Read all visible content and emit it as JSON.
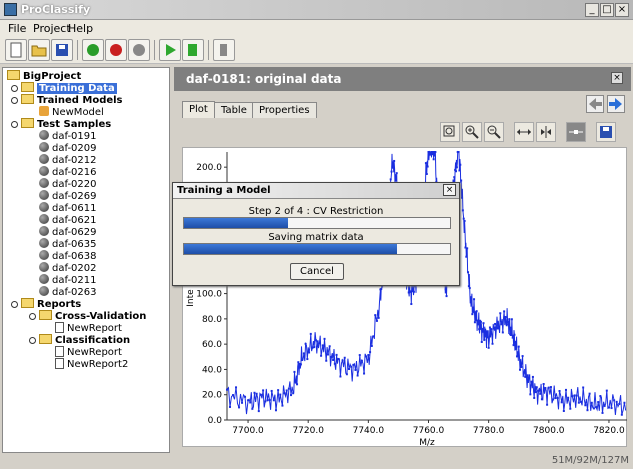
{
  "window": {
    "title": "ProClassify"
  },
  "menu": [
    "File",
    "Project",
    "Help"
  ],
  "tree": {
    "root": "BigProject",
    "training_data": "Training Data",
    "trained_models": "Trained Models",
    "new_model": "NewModel",
    "test_samples": "Test Samples",
    "samples": [
      "daf-0191",
      "daf-0209",
      "daf-0212",
      "daf-0216",
      "daf-0220",
      "daf-0269",
      "daf-0611",
      "daf-0621",
      "daf-0629",
      "daf-0635",
      "daf-0638",
      "daf-0202",
      "daf-0211",
      "daf-0263"
    ],
    "reports": "Reports",
    "cross_validation": "Cross-Validation",
    "cv_reports": [
      "NewReport"
    ],
    "classification": "Classification",
    "class_reports": [
      "NewReport",
      "NewReport2"
    ]
  },
  "panel": {
    "title": "daf-0181: original data",
    "tabs": [
      "Plot",
      "Table",
      "Properties"
    ],
    "active_tab": "Plot"
  },
  "chart_data": {
    "type": "line",
    "title": "",
    "xlabel": "M/z",
    "ylabel": "Inte",
    "xlim": [
      7693,
      7826
    ],
    "ylim": [
      0,
      212
    ],
    "x_ticks": [
      "7700.0",
      "7720.0",
      "7740.0",
      "7760.0",
      "7780.0",
      "7800.0",
      "7820.0"
    ],
    "y_ticks": [
      "0.0",
      "20.0",
      "40.0",
      "60.0",
      "80.0",
      "100.0",
      "200.0"
    ],
    "series": [
      {
        "color": "#1a2ee0",
        "x": [
          7693,
          7700,
          7705,
          7710,
          7715,
          7718,
          7722,
          7726,
          7730,
          7735,
          7740,
          7744,
          7746,
          7748,
          7750,
          7752,
          7754,
          7756,
          7758,
          7760,
          7762,
          7764,
          7766,
          7768,
          7770,
          7772,
          7774,
          7776,
          7778,
          7780,
          7783,
          7786,
          7788,
          7790,
          7793,
          7796,
          7800,
          7805,
          7810,
          7815,
          7820,
          7826
        ],
        "y": [
          20,
          14,
          18,
          16,
          25,
          50,
          62,
          55,
          45,
          40,
          48,
          95,
          150,
          205,
          180,
          120,
          100,
          110,
          170,
          212,
          215,
          140,
          100,
          180,
          215,
          150,
          95,
          80,
          70,
          65,
          75,
          80,
          68,
          50,
          32,
          22,
          22,
          15,
          18,
          12,
          14,
          10
        ]
      }
    ]
  },
  "dialog": {
    "title": "Training a Model",
    "step_text": "Step 2 of 4 : CV Restriction",
    "step_progress": 0.39,
    "sub_text": "Saving matrix data",
    "sub_progress": 0.8,
    "cancel_label": "Cancel"
  },
  "status": {
    "memory": "51M/92M/127M"
  }
}
